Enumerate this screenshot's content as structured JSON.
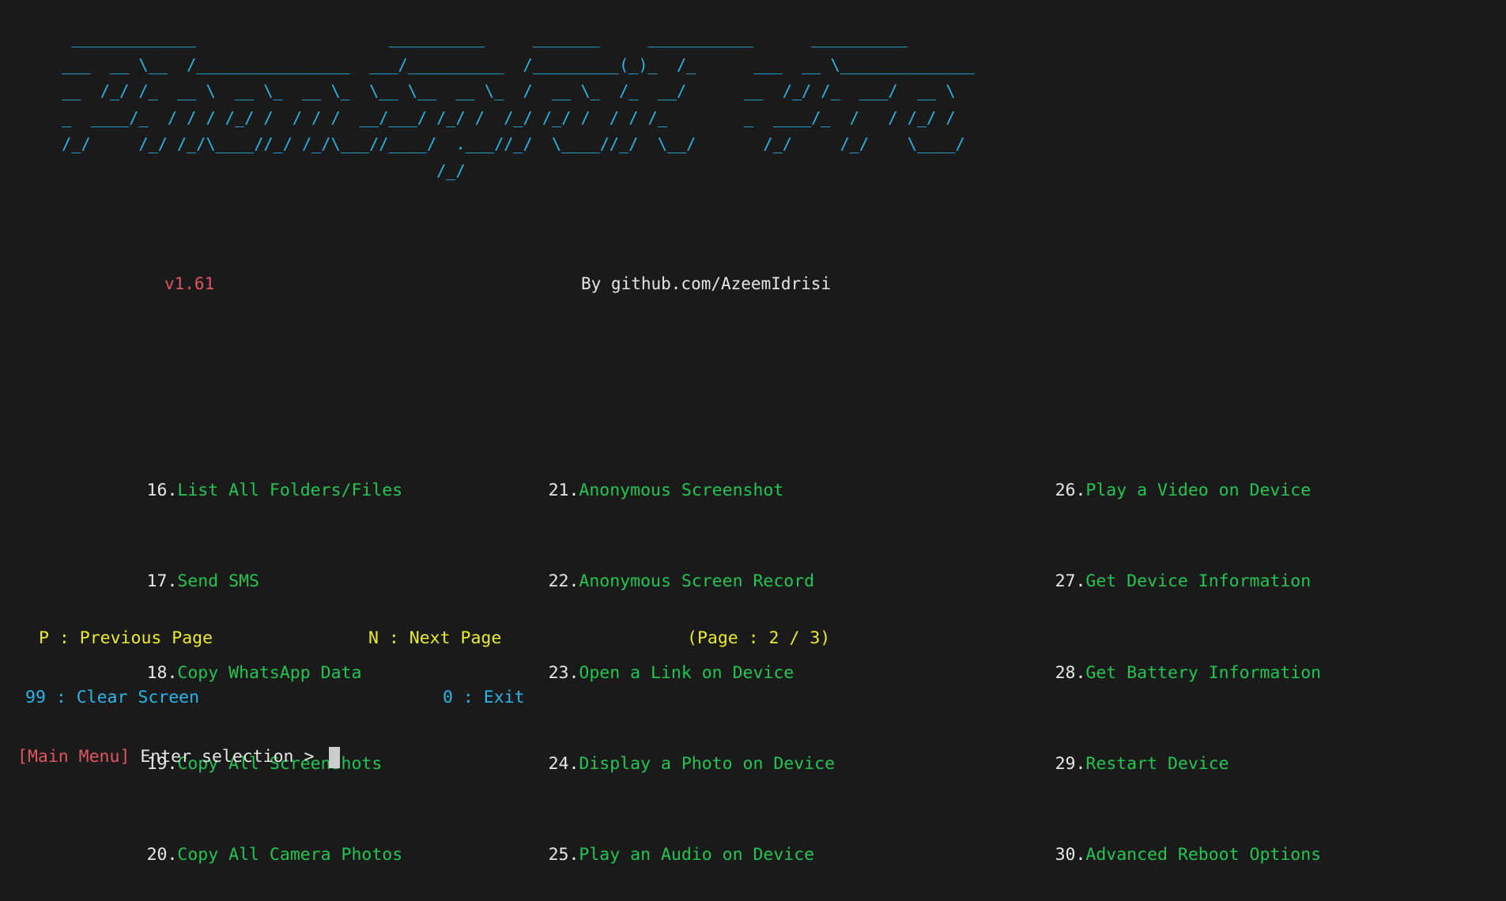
{
  "terminal": {
    "background_color": "#1a1a1a",
    "banner_color": "#29b6e8",
    "banner_art": "  _____________                    __________     _______     ___________      __________\n ___  __ \\__  /________________  ___/__________  /_________(_)_  /_      ___  __ \\______________\n __  /_/ /_  __ \\  __ \\_  __ \\_  \\__ \\__  __ \\_  /  __ \\_  /_  __/      __  /_/ /_  ___/  __ \\\n _  ____/_  / / / /_/ /  / / /  __/___/ /_/ /  /_/ /_/ /  / / /_        _  ____/_  /   / /_/ /\n /_/     /_/ /_/\\____//_/ /_/\\___//____/  .___//_/  \\____//_/  \\__/       /_/     /_/    \\____/\n                                        /_/"
  },
  "meta": {
    "version": "v1.61",
    "author": "By github.com/AzeemIdrisi",
    "version_color": "#e05561",
    "author_color": "#e6e6e6"
  },
  "menu": {
    "number_color": "#e8e8e8",
    "label_color": "#23c552",
    "columns": [
      {
        "items": [
          {
            "num": "16.",
            "label": "List All Folders/Files"
          },
          {
            "num": "17.",
            "label": "Send SMS"
          },
          {
            "num": "18.",
            "label": "Copy WhatsApp Data"
          },
          {
            "num": "19.",
            "label": "Copy All Screenshots"
          },
          {
            "num": "20.",
            "label": "Copy All Camera Photos"
          }
        ]
      },
      {
        "items": [
          {
            "num": "21.",
            "label": "Anonymous Screenshot"
          },
          {
            "num": "22.",
            "label": "Anonymous Screen Record"
          },
          {
            "num": "23.",
            "label": "Open a Link on Device"
          },
          {
            "num": "24.",
            "label": "Display a Photo on Device"
          },
          {
            "num": "25.",
            "label": "Play an Audio on Device"
          }
        ]
      },
      {
        "items": [
          {
            "num": "26.",
            "label": "Play a Video on Device"
          },
          {
            "num": "27.",
            "label": "Get Device Information"
          },
          {
            "num": "28.",
            "label": "Get Battery Information"
          },
          {
            "num": "29.",
            "label": "Restart Device"
          },
          {
            "num": "30.",
            "label": "Advanced Reboot Options"
          }
        ]
      }
    ]
  },
  "navigation": {
    "color": "#eaeb2c",
    "previous_page": "P : Previous Page",
    "next_page": "N : Next Page",
    "page_indicator": "(Page : 2 / 3)",
    "current_page": 2,
    "total_pages": 3
  },
  "utilities": {
    "color": "#29b6e8",
    "clear_screen": "99 : Clear Screen",
    "exit": "0 : Exit"
  },
  "prompt": {
    "context": "[Main Menu]",
    "context_color": "#e05561",
    "text": " Enter selection > ",
    "text_color": "#e6e6e6",
    "input_value": "",
    "cursor_color": "#cdcdcd"
  }
}
